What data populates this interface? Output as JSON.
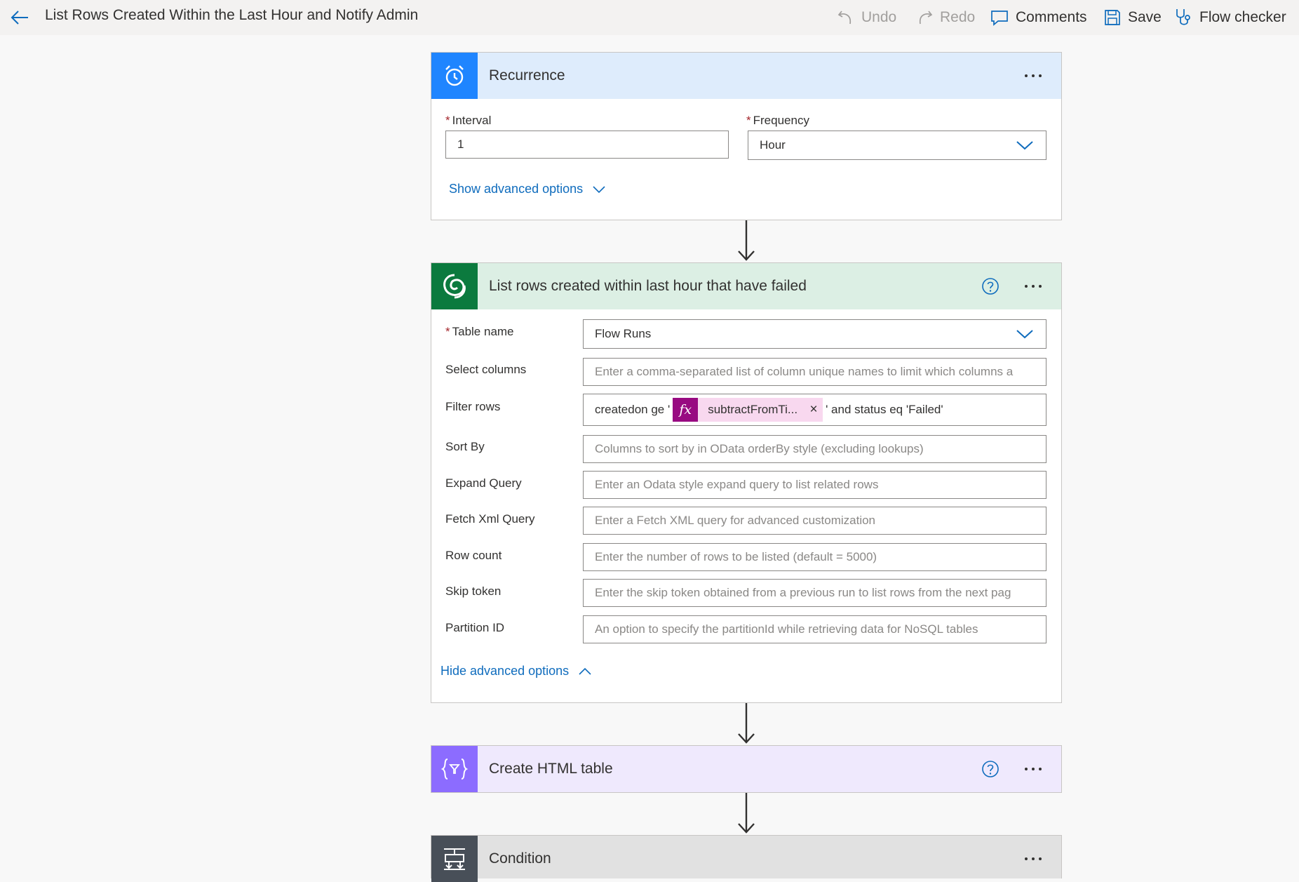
{
  "header": {
    "title": "List Rows Created Within the Last Hour and Notify Admin",
    "undo": "Undo",
    "redo": "Redo",
    "comments": "Comments",
    "save": "Save",
    "flow_checker": "Flow checker"
  },
  "recurrence": {
    "title": "Recurrence",
    "interval_label": "Interval",
    "interval_value": "1",
    "frequency_label": "Frequency",
    "frequency_value": "Hour",
    "advanced_toggle": "Show advanced options",
    "color": "#1f85ff",
    "header_bg": "#deecfc"
  },
  "list_rows": {
    "title": "List rows created within last hour that have failed",
    "color": "#0b7a3e",
    "header_bg": "#dcefe4",
    "fields": {
      "table_name": {
        "label": "Table name",
        "value": "Flow Runs"
      },
      "select_columns": {
        "label": "Select columns",
        "placeholder": "Enter a comma-separated list of column unique names to limit which columns a"
      },
      "filter_rows": {
        "label": "Filter rows",
        "prefix": "createdon ge '",
        "token_icon": "fx",
        "token_text": "subtractFromTi...",
        "token_remove": "×",
        "suffix": "' and status eq 'Failed'"
      },
      "sort_by": {
        "label": "Sort By",
        "placeholder": "Columns to sort by in OData orderBy style (excluding lookups)"
      },
      "expand_query": {
        "label": "Expand Query",
        "placeholder": "Enter an Odata style expand query to list related rows"
      },
      "fetch_xml": {
        "label": "Fetch Xml Query",
        "placeholder": "Enter a Fetch XML query for advanced customization"
      },
      "row_count": {
        "label": "Row count",
        "placeholder": "Enter the number of rows to be listed (default = 5000)"
      },
      "skip_token": {
        "label": "Skip token",
        "placeholder": "Enter the skip token obtained from a previous run to list rows from the next pag"
      },
      "partition_id": {
        "label": "Partition ID",
        "placeholder": "An option to specify the partitionId while retrieving data for NoSQL tables"
      }
    },
    "advanced_toggle": "Hide advanced options"
  },
  "html_table": {
    "title": "Create HTML table",
    "color": "#8c6cff",
    "header_bg": "#efe9fd"
  },
  "condition": {
    "title": "Condition",
    "color": "#484f58",
    "header_bg": "#e1e1e1"
  }
}
